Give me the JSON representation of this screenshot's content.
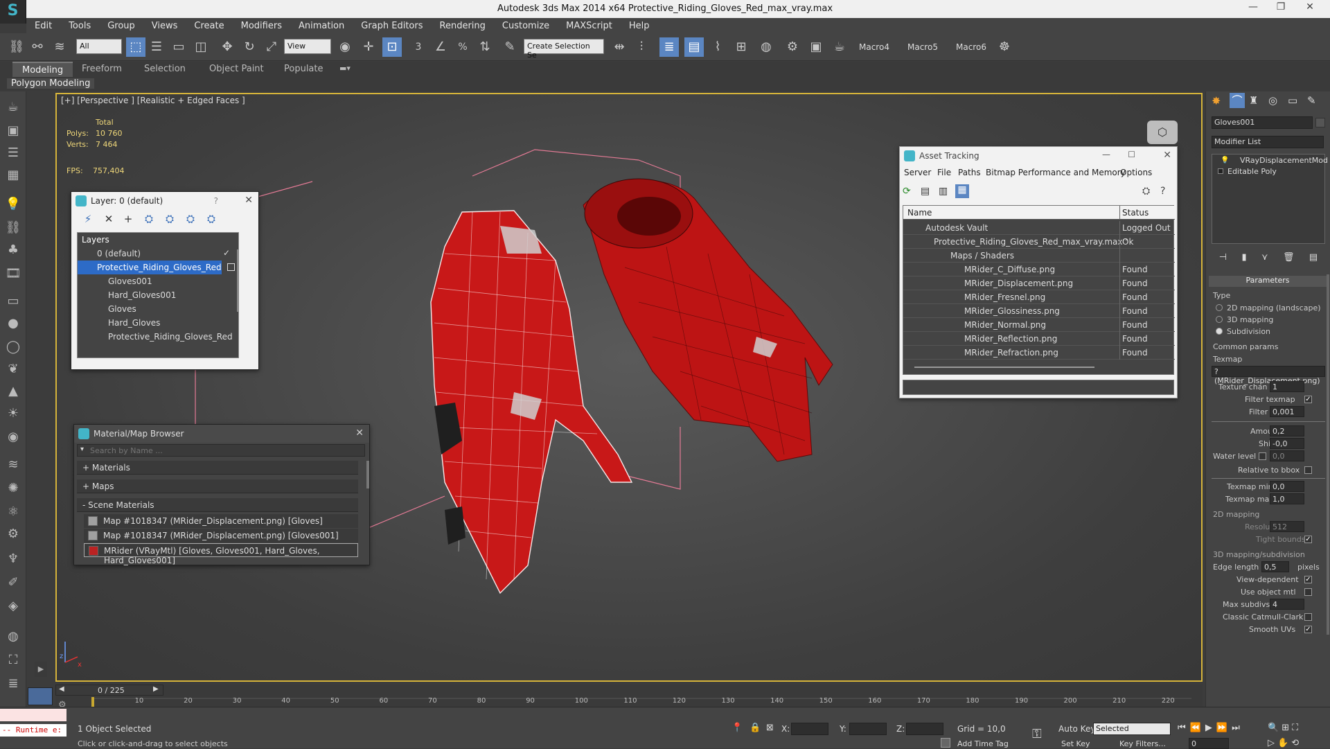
{
  "app": {
    "title": "Autodesk 3ds Max  2014 x64     Protective_Riding_Gloves_Red_max_vray.max",
    "window_controls": [
      "—",
      "❐",
      "✕"
    ],
    "logo": "S"
  },
  "menu": [
    "Edit",
    "Tools",
    "Group",
    "Views",
    "Create",
    "Modifiers",
    "Animation",
    "Graph Editors",
    "Rendering",
    "Customize",
    "MAXScript",
    "Help"
  ],
  "toolbar": {
    "filter": "All",
    "refcoord": "View",
    "selection_set": "Create Selection Se",
    "snap_3": "3",
    "snap_percent": "%",
    "macros": [
      "Macro4",
      "Macro5",
      "Macro6"
    ]
  },
  "ribbon": {
    "tabs": [
      "Modeling",
      "Freeform",
      "Selection",
      "Object Paint",
      "Populate"
    ],
    "active": "Modeling",
    "sub": "Polygon Modeling"
  },
  "viewport": {
    "label": "[+] [Perspective ] [Realistic + Edged Faces ]",
    "stats": {
      "total_label": "Total",
      "polys_label": "Polys:",
      "polys": "10 760",
      "verts_label": "Verts:",
      "verts": "7 464",
      "fps_label": "FPS:",
      "fps": "757,404"
    },
    "axis_z": "z",
    "axis_x": "x"
  },
  "layer_window": {
    "title": "Layer: 0 (default)",
    "help": "?",
    "header": "Layers",
    "rows": [
      {
        "label": "0 (default)",
        "indent": 0
      },
      {
        "label": "Protective_Riding_Gloves_Red",
        "indent": 0
      },
      {
        "label": "Gloves001",
        "indent": 1
      },
      {
        "label": "Hard_Gloves001",
        "indent": 1
      },
      {
        "label": "Gloves",
        "indent": 1
      },
      {
        "label": "Hard_Gloves",
        "indent": 1
      },
      {
        "label": "Protective_Riding_Gloves_Red",
        "indent": 1
      }
    ]
  },
  "material_browser": {
    "title": "Material/Map Browser",
    "search_placeholder": "Search by Name ...",
    "sections": [
      "+ Materials",
      "+ Maps",
      "- Scene Materials"
    ],
    "items": [
      "Map #1018347 (MRider_Displacement.png) [Gloves]",
      "Map #1018347 (MRider_Displacement.png) [Gloves001]",
      "MRider  (VRayMtl) [Gloves, Gloves001, Hard_Gloves, Hard_Gloves001]"
    ]
  },
  "asset_tracking": {
    "title": "Asset Tracking",
    "menu": [
      "Server",
      "File",
      "Paths",
      "Bitmap Performance and Memory",
      "Options"
    ],
    "col_name": "Name",
    "col_status": "Status",
    "rows": [
      {
        "name": "Autodesk Vault",
        "status": "Logged Out ..",
        "indent": 1
      },
      {
        "name": "Protective_Riding_Gloves_Red_max_vray.max",
        "status": "Ok",
        "indent": 2
      },
      {
        "name": "Maps / Shaders",
        "status": "",
        "indent": 3
      },
      {
        "name": "MRider_C_Diffuse.png",
        "status": "Found",
        "indent": 4
      },
      {
        "name": "MRider_Displacement.png",
        "status": "Found",
        "indent": 4
      },
      {
        "name": "MRider_Fresnel.png",
        "status": "Found",
        "indent": 4
      },
      {
        "name": "MRider_Glossiness.png",
        "status": "Found",
        "indent": 4
      },
      {
        "name": "MRider_Normal.png",
        "status": "Found",
        "indent": 4
      },
      {
        "name": "MRider_Reflection.png",
        "status": "Found",
        "indent": 4
      },
      {
        "name": "MRider_Refraction.png",
        "status": "Found",
        "indent": 4
      }
    ]
  },
  "command_panel": {
    "object_name": "Gloves001",
    "modifier_list": "Modifier List",
    "stack": [
      "VRayDisplacementMod",
      "Editable Poly"
    ],
    "params_title": "Parameters",
    "type_label": "Type",
    "type_options": [
      "2D mapping (landscape)",
      "3D mapping",
      "Subdivision"
    ],
    "type_selected": 2,
    "common_params": "Common params",
    "texmap_label": "Texmap",
    "texmap_value": "? (MRider_Displacement.png)",
    "texture_chan_label": "Texture chan",
    "texture_chan": "1",
    "filter_texmap_label": "Filter texmap",
    "filter_blur_label": "Filter blur",
    "filter_blur": "0,001",
    "amount_label": "Amount",
    "amount": "0,2",
    "shift_label": "Shift",
    "shift": "-0,0",
    "water_level_label": "Water level",
    "water_level": "0,0",
    "relative_bbox_label": "Relative to bbox",
    "texmap_min_label": "Texmap min",
    "texmap_min": "0,0",
    "texmap_max_label": "Texmap max",
    "texmap_max": "1,0",
    "mapping2d_title": "2D mapping",
    "resolution_label": "Resolution",
    "resolution": "512",
    "tight_bounds_label": "Tight bounds",
    "mapping3d_title": "3D mapping/subdivision",
    "edge_length_label": "Edge length",
    "edge_length": "0,5",
    "pixels_label": "pixels",
    "view_dependent_label": "View-dependent",
    "use_object_mtl_label": "Use object mtl",
    "max_subdivs_label": "Max subdivs",
    "max_subdivs": "4",
    "classic_cc_label": "Classic Catmull-Clark",
    "smooth_uvs_label": "Smooth UVs"
  },
  "timeline": {
    "frame": "0 / 225",
    "ticks": [
      "10",
      "20",
      "30",
      "40",
      "50",
      "60",
      "70",
      "80",
      "90",
      "100",
      "110",
      "120",
      "130",
      "140",
      "150",
      "160",
      "170",
      "180",
      "190",
      "200",
      "210",
      "220"
    ]
  },
  "status": {
    "script": "-- Runtime e:",
    "selected": "1 Object Selected",
    "prompt": "Click or click-and-drag to select objects",
    "x_label": "X:",
    "y_label": "Y:",
    "z_label": "Z:",
    "grid": "Grid = 10,0",
    "add_time_tag": "Add Time Tag",
    "auto_key": "Auto Key",
    "set_key": "Set Key",
    "key_mode": "Selected",
    "key_filters": "Key Filters...",
    "frame_field": "0"
  },
  "colors": {
    "viewport_border": "#d6b43a",
    "selection_blue": "#2d6bc7",
    "glove_red": "#d01818",
    "bbox_pink": "#e57b96",
    "stats_yellow": "#f0d87a"
  }
}
